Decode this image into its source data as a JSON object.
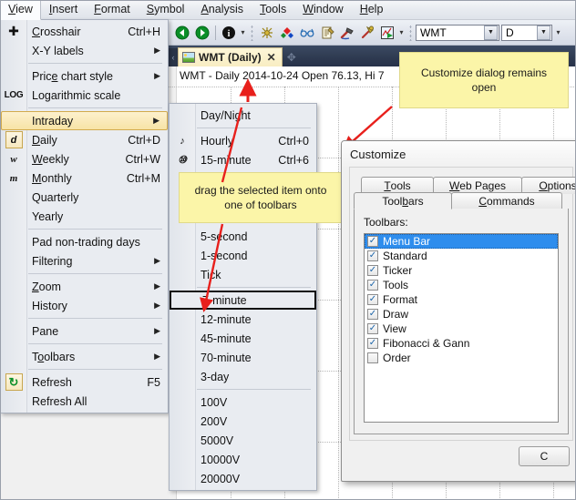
{
  "menubar": {
    "items": [
      {
        "label": "View",
        "open": true
      },
      {
        "label": "Insert",
        "open": false
      },
      {
        "label": "Format",
        "open": false
      },
      {
        "label": "Symbol",
        "open": false
      },
      {
        "label": "Analysis",
        "open": false
      },
      {
        "label": "Tools",
        "open": false
      },
      {
        "label": "Window",
        "open": false
      },
      {
        "label": "Help",
        "open": false
      }
    ]
  },
  "toolbar": {
    "icons": [
      {
        "name": "back-icon",
        "glyph": "◀"
      },
      {
        "name": "forward-icon",
        "glyph": "▶"
      },
      {
        "name": "info-icon",
        "glyph": "i"
      },
      {
        "name": "spider-tool-icon",
        "glyph": "☸"
      },
      {
        "name": "colors-icon",
        "glyph": "♦"
      },
      {
        "name": "glasses-icon",
        "glyph": "◎"
      },
      {
        "name": "notes-icon",
        "glyph": "✎"
      },
      {
        "name": "hammer-icon",
        "glyph": "⚒"
      },
      {
        "name": "pick-icon",
        "glyph": "⛏"
      },
      {
        "name": "run-chart-icon",
        "glyph": "▶"
      }
    ],
    "symbol_combo": {
      "value": "WMT"
    },
    "period_combo": {
      "value": "D"
    }
  },
  "tabstrip": {
    "tab_label": "WMT (Daily)",
    "close_glyph": "✕",
    "add_glyph": "✥"
  },
  "chart": {
    "title": "WMT - Daily 2014-10-24 Open 76.13, Hi 7"
  },
  "view_menu": {
    "items": [
      {
        "type": "item",
        "icon": "crosshair-icon",
        "icon_glyph": "✚",
        "label": "Crosshair",
        "underline": "C",
        "accel": "Ctrl+H",
        "arrow": false
      },
      {
        "type": "item",
        "icon": "",
        "icon_glyph": "",
        "label": "X-Y labels",
        "underline": "",
        "accel": "",
        "arrow": true
      },
      {
        "type": "sep"
      },
      {
        "type": "item",
        "icon": "",
        "icon_glyph": "",
        "label": "Price chart style",
        "underline": "e",
        "accel": "",
        "arrow": true
      },
      {
        "type": "item",
        "icon": "log-icon",
        "icon_glyph": "LOG",
        "label": "Logarithmic scale",
        "underline": "",
        "accel": "",
        "arrow": false
      },
      {
        "type": "sep"
      },
      {
        "type": "item",
        "icon": "",
        "icon_glyph": "",
        "label": "Intraday",
        "underline": "",
        "accel": "",
        "arrow": true,
        "highlight": true
      },
      {
        "type": "item",
        "icon": "daily-icon",
        "icon_glyph": "d",
        "label": "Daily",
        "underline": "D",
        "accel": "Ctrl+D",
        "arrow": false,
        "boxed_icon": true
      },
      {
        "type": "item",
        "icon": "weekly-icon",
        "icon_glyph": "w",
        "label": "Weekly",
        "underline": "W",
        "accel": "Ctrl+W",
        "arrow": false
      },
      {
        "type": "item",
        "icon": "monthly-icon",
        "icon_glyph": "m",
        "label": "Monthly",
        "underline": "M",
        "accel": "Ctrl+M",
        "arrow": false
      },
      {
        "type": "item",
        "icon": "",
        "icon_glyph": "",
        "label": "Quarterly",
        "underline": "",
        "accel": "",
        "arrow": false
      },
      {
        "type": "item",
        "icon": "",
        "icon_glyph": "",
        "label": "Yearly",
        "underline": "",
        "accel": "",
        "arrow": false
      },
      {
        "type": "sep"
      },
      {
        "type": "item",
        "icon": "",
        "icon_glyph": "",
        "label": "Pad non-trading days",
        "underline": "",
        "accel": "",
        "arrow": false
      },
      {
        "type": "item",
        "icon": "",
        "icon_glyph": "",
        "label": "Filtering",
        "underline": "",
        "accel": "",
        "arrow": true
      },
      {
        "type": "sep"
      },
      {
        "type": "item",
        "icon": "",
        "icon_glyph": "",
        "label": "Zoom",
        "underline": "Z",
        "accel": "",
        "arrow": true
      },
      {
        "type": "item",
        "icon": "",
        "icon_glyph": "",
        "label": "History",
        "underline": "",
        "accel": "",
        "arrow": true
      },
      {
        "type": "sep"
      },
      {
        "type": "item",
        "icon": "",
        "icon_glyph": "",
        "label": "Pane",
        "underline": "",
        "accel": "",
        "arrow": true
      },
      {
        "type": "sep"
      },
      {
        "type": "item",
        "icon": "",
        "icon_glyph": "",
        "label": "Toolbars",
        "underline": "o",
        "accel": "",
        "arrow": true
      },
      {
        "type": "sep"
      },
      {
        "type": "item",
        "icon": "refresh-icon",
        "icon_glyph": "↻",
        "label": "Refresh",
        "underline": "",
        "accel": "F5",
        "arrow": false,
        "boxed_icon": true
      },
      {
        "type": "item",
        "icon": "",
        "icon_glyph": "",
        "label": "Refresh All",
        "underline": "",
        "accel": "",
        "arrow": false
      }
    ]
  },
  "intraday_menu": {
    "items": [
      {
        "type": "item",
        "icon": "",
        "icon_glyph": "",
        "label": "Day/Night",
        "accel": "",
        "arrow": false
      },
      {
        "type": "sep"
      },
      {
        "type": "item",
        "icon": "hourly-icon",
        "icon_glyph": "♪",
        "label": "Hourly",
        "accel": "Ctrl+0",
        "arrow": false
      },
      {
        "type": "item",
        "icon": "fifteen-minute-icon",
        "icon_glyph": "⑩",
        "label": "15-minute",
        "accel": "Ctrl+6",
        "arrow": false
      },
      {
        "type": "hidden"
      },
      {
        "type": "hidden"
      },
      {
        "type": "hidden"
      },
      {
        "type": "item",
        "icon": "",
        "icon_glyph": "",
        "label": "5-second",
        "accel": "",
        "arrow": false
      },
      {
        "type": "item",
        "icon": "",
        "icon_glyph": "",
        "label": "1-second",
        "accel": "",
        "arrow": false
      },
      {
        "type": "item",
        "icon": "",
        "icon_glyph": "",
        "label": "Tick",
        "accel": "",
        "arrow": false
      },
      {
        "type": "sep"
      },
      {
        "type": "item",
        "icon": "",
        "icon_glyph": "",
        "label": "7-minute",
        "accel": "",
        "arrow": false,
        "boxed": true
      },
      {
        "type": "item",
        "icon": "",
        "icon_glyph": "",
        "label": "12-minute",
        "accel": "",
        "arrow": false
      },
      {
        "type": "item",
        "icon": "",
        "icon_glyph": "",
        "label": "45-minute",
        "accel": "",
        "arrow": false
      },
      {
        "type": "item",
        "icon": "",
        "icon_glyph": "",
        "label": "70-minute",
        "accel": "",
        "arrow": false
      },
      {
        "type": "item",
        "icon": "",
        "icon_glyph": "",
        "label": "3-day",
        "accel": "",
        "arrow": false
      },
      {
        "type": "sep"
      },
      {
        "type": "item",
        "icon": "",
        "icon_glyph": "",
        "label": "100V",
        "accel": "",
        "arrow": false
      },
      {
        "type": "item",
        "icon": "",
        "icon_glyph": "",
        "label": "200V",
        "accel": "",
        "arrow": false
      },
      {
        "type": "item",
        "icon": "",
        "icon_glyph": "",
        "label": "5000V",
        "accel": "",
        "arrow": false
      },
      {
        "type": "item",
        "icon": "",
        "icon_glyph": "",
        "label": "10000V",
        "accel": "",
        "arrow": false
      },
      {
        "type": "item",
        "icon": "",
        "icon_glyph": "",
        "label": "20000V",
        "accel": "",
        "arrow": false
      }
    ]
  },
  "callouts": {
    "top": "Customize dialog remains open",
    "drag": "drag the selected item onto one of toolbars"
  },
  "dialog": {
    "title": "Customize",
    "tabs_back": [
      {
        "label": "Tools",
        "underline": "T"
      },
      {
        "label": "Web Pages",
        "underline": "W"
      },
      {
        "label": "Options",
        "underline": "O"
      }
    ],
    "tabs_front": [
      {
        "label": "Toolbars",
        "underline": "b",
        "active": true
      },
      {
        "label": "Commands",
        "underline": "C",
        "active": false
      }
    ],
    "panel_label": "Toolbars:",
    "toolbars": [
      {
        "label": "Menu Bar",
        "checked": true,
        "selected": true
      },
      {
        "label": "Standard",
        "checked": true,
        "selected": false
      },
      {
        "label": "Ticker",
        "checked": true,
        "selected": false
      },
      {
        "label": "Tools",
        "checked": true,
        "selected": false
      },
      {
        "label": "Format",
        "checked": true,
        "selected": false
      },
      {
        "label": "Draw",
        "checked": true,
        "selected": false
      },
      {
        "label": "View",
        "checked": true,
        "selected": false
      },
      {
        "label": "Fibonacci & Gann",
        "checked": true,
        "selected": false
      },
      {
        "label": "Order",
        "checked": false,
        "selected": false
      }
    ],
    "close_button": "C"
  },
  "colors": {
    "selection_blue": "#2e8ded",
    "callout_yellow": "#fbf5a8",
    "arrow_red": "#e8201c",
    "highlight_gold": "#f7e3a6",
    "tab_strip_dark": "#2e3a50"
  }
}
